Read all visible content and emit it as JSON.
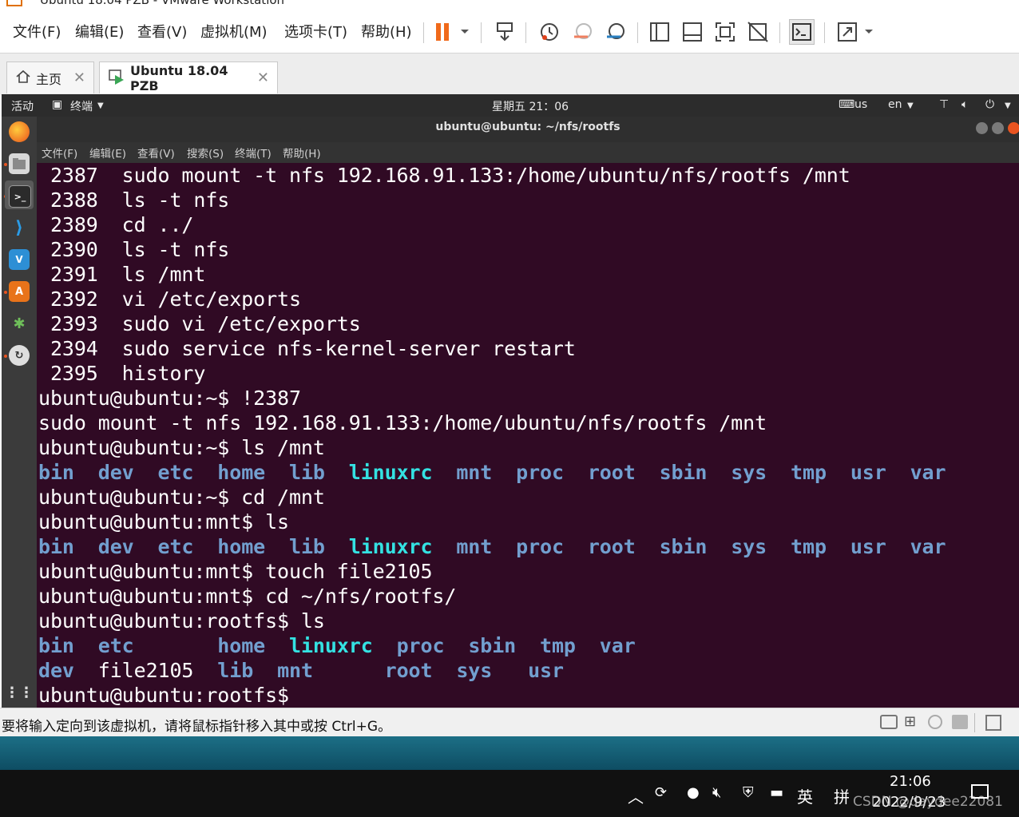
{
  "window": {
    "title": "Ubuntu 18.04 PZB - VMware Workstation"
  },
  "vmware_menu": [
    {
      "label": "文件(F)"
    },
    {
      "label": "编辑(E)"
    },
    {
      "label": "查看(V)"
    },
    {
      "label": "虚拟机(M)"
    },
    {
      "label": "选项卡(T)"
    },
    {
      "label": "帮助(H)"
    }
  ],
  "toolbar_icons": [
    "pause-icon",
    "send-ctrl-alt-del-icon",
    "snapshot-icon",
    "revert-snapshot-icon",
    "snapshot-manager-icon",
    "library-icon",
    "thumbnail-icon",
    "fullscreen-icon",
    "unity-icon",
    "console-view-icon",
    "stretch-icon"
  ],
  "tabs": [
    {
      "label": "主页",
      "icon": "home-icon"
    },
    {
      "label": "Ubuntu 18.04 PZB",
      "icon": "vm-icon"
    }
  ],
  "ubuntu_panel": {
    "activities": "活动",
    "app_menu": "终端",
    "clock": "星期五 21：06",
    "keyboard": "us",
    "language": "en"
  },
  "dock_apps": [
    "firefox-icon",
    "files-icon",
    "terminal-icon",
    "vscode-icon",
    "virtualbox-icon",
    "software-center-icon",
    "network-tool-icon",
    "updater-icon",
    "show-apps-icon"
  ],
  "terminal": {
    "title": "ubuntu@ubuntu: ~/nfs/rootfs",
    "menu": [
      "文件(F)",
      "编辑(E)",
      "查看(V)",
      "搜索(S)",
      "终端(T)",
      "帮助(H)"
    ],
    "history": [
      {
        "num": "2387",
        "cmd": "sudo mount -t nfs 192.168.91.133:/home/ubuntu/nfs/rootfs /mnt"
      },
      {
        "num": "2388",
        "cmd": "ls -t nfs"
      },
      {
        "num": "2389",
        "cmd": "cd ../"
      },
      {
        "num": "2390",
        "cmd": "ls -t nfs"
      },
      {
        "num": "2391",
        "cmd": "ls /mnt"
      },
      {
        "num": "2392",
        "cmd": "vi /etc/exports"
      },
      {
        "num": "2393",
        "cmd": "sudo vi /etc/exports"
      },
      {
        "num": "2394",
        "cmd": "sudo service nfs-kernel-server restart"
      },
      {
        "num": "2395",
        "cmd": "history"
      }
    ],
    "lines": {
      "p1": "ubuntu@ubuntu:~$ !2387",
      "echo1": "sudo mount -t nfs 192.168.91.133:/home/ubuntu/nfs/rootfs /mnt",
      "p2": "ubuntu@ubuntu:~$ ls /mnt",
      "p3": "ubuntu@ubuntu:~$ cd /mnt",
      "p4": "ubuntu@ubuntu:mnt$ ls",
      "p5": "ubuntu@ubuntu:mnt$ touch file2105",
      "p6": "ubuntu@ubuntu:mnt$ cd ~/nfs/rootfs/",
      "p7": "ubuntu@ubuntu:rootfs$ ls",
      "p8": "ubuntu@ubuntu:rootfs$"
    },
    "mnt_listing": [
      "bin",
      "dev",
      "etc",
      "home",
      "lib",
      "linuxrc",
      "mnt",
      "proc",
      "root",
      "sbin",
      "sys",
      "tmp",
      "usr",
      "var"
    ],
    "rootfs_row1": [
      "bin",
      "etc",
      "home",
      "linuxrc",
      "proc",
      "sbin",
      "tmp",
      "var"
    ],
    "rootfs_row2": [
      "dev",
      "file2105",
      "lib",
      "mnt",
      "root",
      "sys",
      "usr"
    ]
  },
  "statusbar": {
    "message": "要将输入定向到该虚拟机，请将鼠标指针移入其中或按 Ctrl+G。"
  },
  "taskbar": {
    "ime": "英",
    "ime2": "拼",
    "time": "21:06",
    "date": "2022/9/23",
    "watermark": "CSDN @daydee22081"
  },
  "colors": {
    "terminal_bg": "#300a24",
    "dir": "#729fcf",
    "exec": "#34e2e2",
    "ubuntu_orange": "#e95420"
  }
}
